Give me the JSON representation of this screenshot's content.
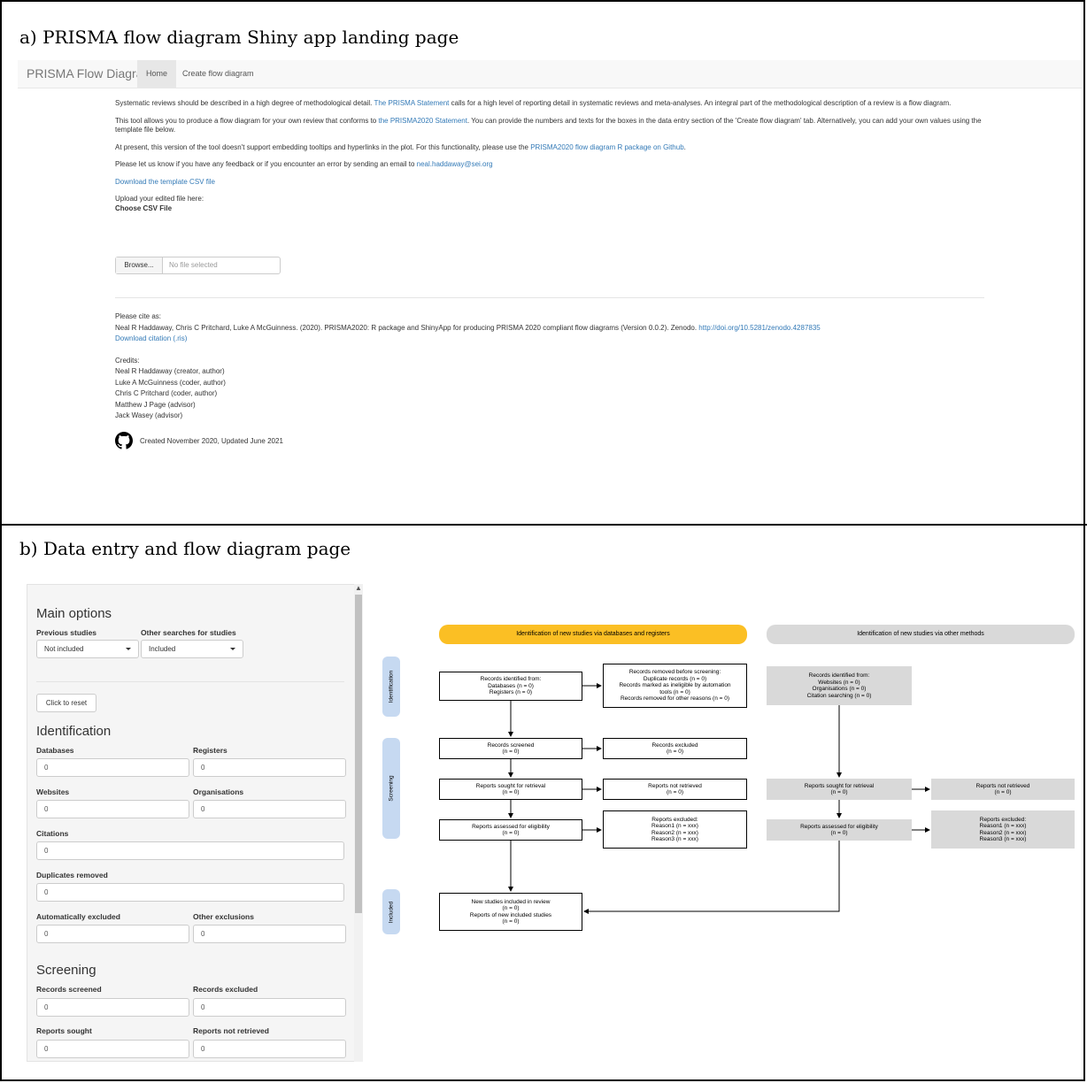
{
  "panels": {
    "a_title": "a) PRISMA flow diagram Shiny app landing page",
    "b_title": "b) Data entry and flow diagram page"
  },
  "navbar": {
    "brand": "PRISMA Flow Diagram",
    "tabs": [
      "Home",
      "Create flow diagram"
    ]
  },
  "landing": {
    "p1_a": "Systematic reviews should be described in a high degree of methodological detail. ",
    "p1_link": "The PRISMA Statement",
    "p1_b": " calls for a high level of reporting detail in systematic reviews and meta-analyses. An integral part of the methodological description of a review is a flow diagram.",
    "p2_a": "This tool allows you to produce a flow diagram for your own review that conforms to ",
    "p2_link": "the PRISMA2020 Statement",
    "p2_b": ". You can provide the numbers and texts for the boxes in the data entry section of the 'Create flow diagram' tab. Alternatively, you can add your own values using the template file below.",
    "p3_a": "At present, this version of the tool doesn't support embedding tooltips and hyperlinks in the plot. For this functionality, please use the ",
    "p3_link": "PRISMA2020 flow diagram R package on Github",
    "p3_b": ".",
    "p4_a": "Please let us know if you have any feedback or if you encounter an error by sending an email to ",
    "p4_link": "neal.haddaway@sei.org",
    "download_template": "Download the template CSV file",
    "upload_label": "Upload your edited file here:",
    "choose_label": "Choose CSV File",
    "browse_button": "Browse...",
    "file_placeholder": "No file selected",
    "cite_label": "Please cite as:",
    "citation": "Neal R Haddaway, Chris C Pritchard, Luke A McGuinness. (2020). PRISMA2020: R package and ShinyApp for producing PRISMA 2020 compliant flow diagrams (Version 0.0.2). Zenodo. ",
    "citation_doi": "http://doi.org/10.5281/zenodo.4287835",
    "download_citation": "Download citation (.ris)",
    "credits_label": "Credits:",
    "credits": [
      "Neal R Haddaway (creator, author)",
      "Luke A McGuinness (coder, author)",
      "Chris C Pritchard (coder, author)",
      "Matthew J Page (advisor)",
      "Jack Wasey (advisor)"
    ],
    "footer": "Created November 2020, Updated June 2021"
  },
  "sidebar": {
    "main_options": "Main options",
    "previous_label": "Previous studies",
    "previous_value": "Not included",
    "other_label": "Other searches for studies",
    "other_value": "Included",
    "reset": "Click to reset",
    "identification": "Identification",
    "databases": "Databases",
    "registers": "Registers",
    "websites": "Websites",
    "organisations": "Organisations",
    "citations": "Citations",
    "duplicates": "Duplicates removed",
    "auto_excluded": "Automatically excluded",
    "other_exclusions": "Other exclusions",
    "screening": "Screening",
    "records_screened": "Records screened",
    "records_excluded": "Records excluded",
    "reports_sought": "Reports sought",
    "reports_not_retrieved": "Reports not retrieved",
    "zero": "0"
  },
  "diagram": {
    "header_db": "Identification of new studies via databases and registers",
    "header_other": "Identification of new studies via other methods",
    "side_identification": "Identification",
    "side_screening": "Screening",
    "side_included": "Included",
    "db_identified": [
      "Records identified from:",
      "Databases (n = 0)",
      "Registers (n = 0)"
    ],
    "db_removed": [
      "Records removed before screening:",
      "Duplicate records (n = 0)",
      "Records marked as ineligible by automation",
      "tools (n = 0)",
      "Records removed for other reasons (n = 0)"
    ],
    "db_screened": [
      "Records screened",
      "(n = 0)"
    ],
    "db_excluded": [
      "Records excluded",
      "(n = 0)"
    ],
    "db_sought": [
      "Reports sought for retrieval",
      "(n = 0)"
    ],
    "db_not_retrieved": [
      "Reports not retrieved",
      "(n = 0)"
    ],
    "db_assessed": [
      "Reports assessed for eligibility",
      "(n = 0)"
    ],
    "db_reports_excluded": [
      "Reports excluded:",
      "Reason1 (n = xxx)",
      "Reason2 (n = xxx)",
      "Reason3 (n = xxx)"
    ],
    "included": [
      "New studies included in review",
      "(n = 0)",
      "Reports of new included studies",
      "(n = 0)"
    ],
    "other_identified": [
      "Records identified from:",
      "Websites (n = 0)",
      "Organisations (n = 0)",
      "Citation searching (n = 0)"
    ],
    "other_sought": [
      "Reports sought for retrieval",
      "(n = 0)"
    ],
    "other_not_retrieved": [
      "Reports not retrieved",
      "(n = 0)"
    ],
    "other_assessed": [
      "Reports assessed for eligibility",
      "(n = 0)"
    ],
    "other_reports_excluded": [
      "Reports excluded:",
      "Reason1 (n = xxx)",
      "Reason2 (n = xxx)",
      "Reason3 (n = xxx)"
    ],
    "colors": {
      "db_header": "#fbbf24",
      "other_header": "#d9d9d9",
      "side": "#c6d9f1"
    }
  }
}
